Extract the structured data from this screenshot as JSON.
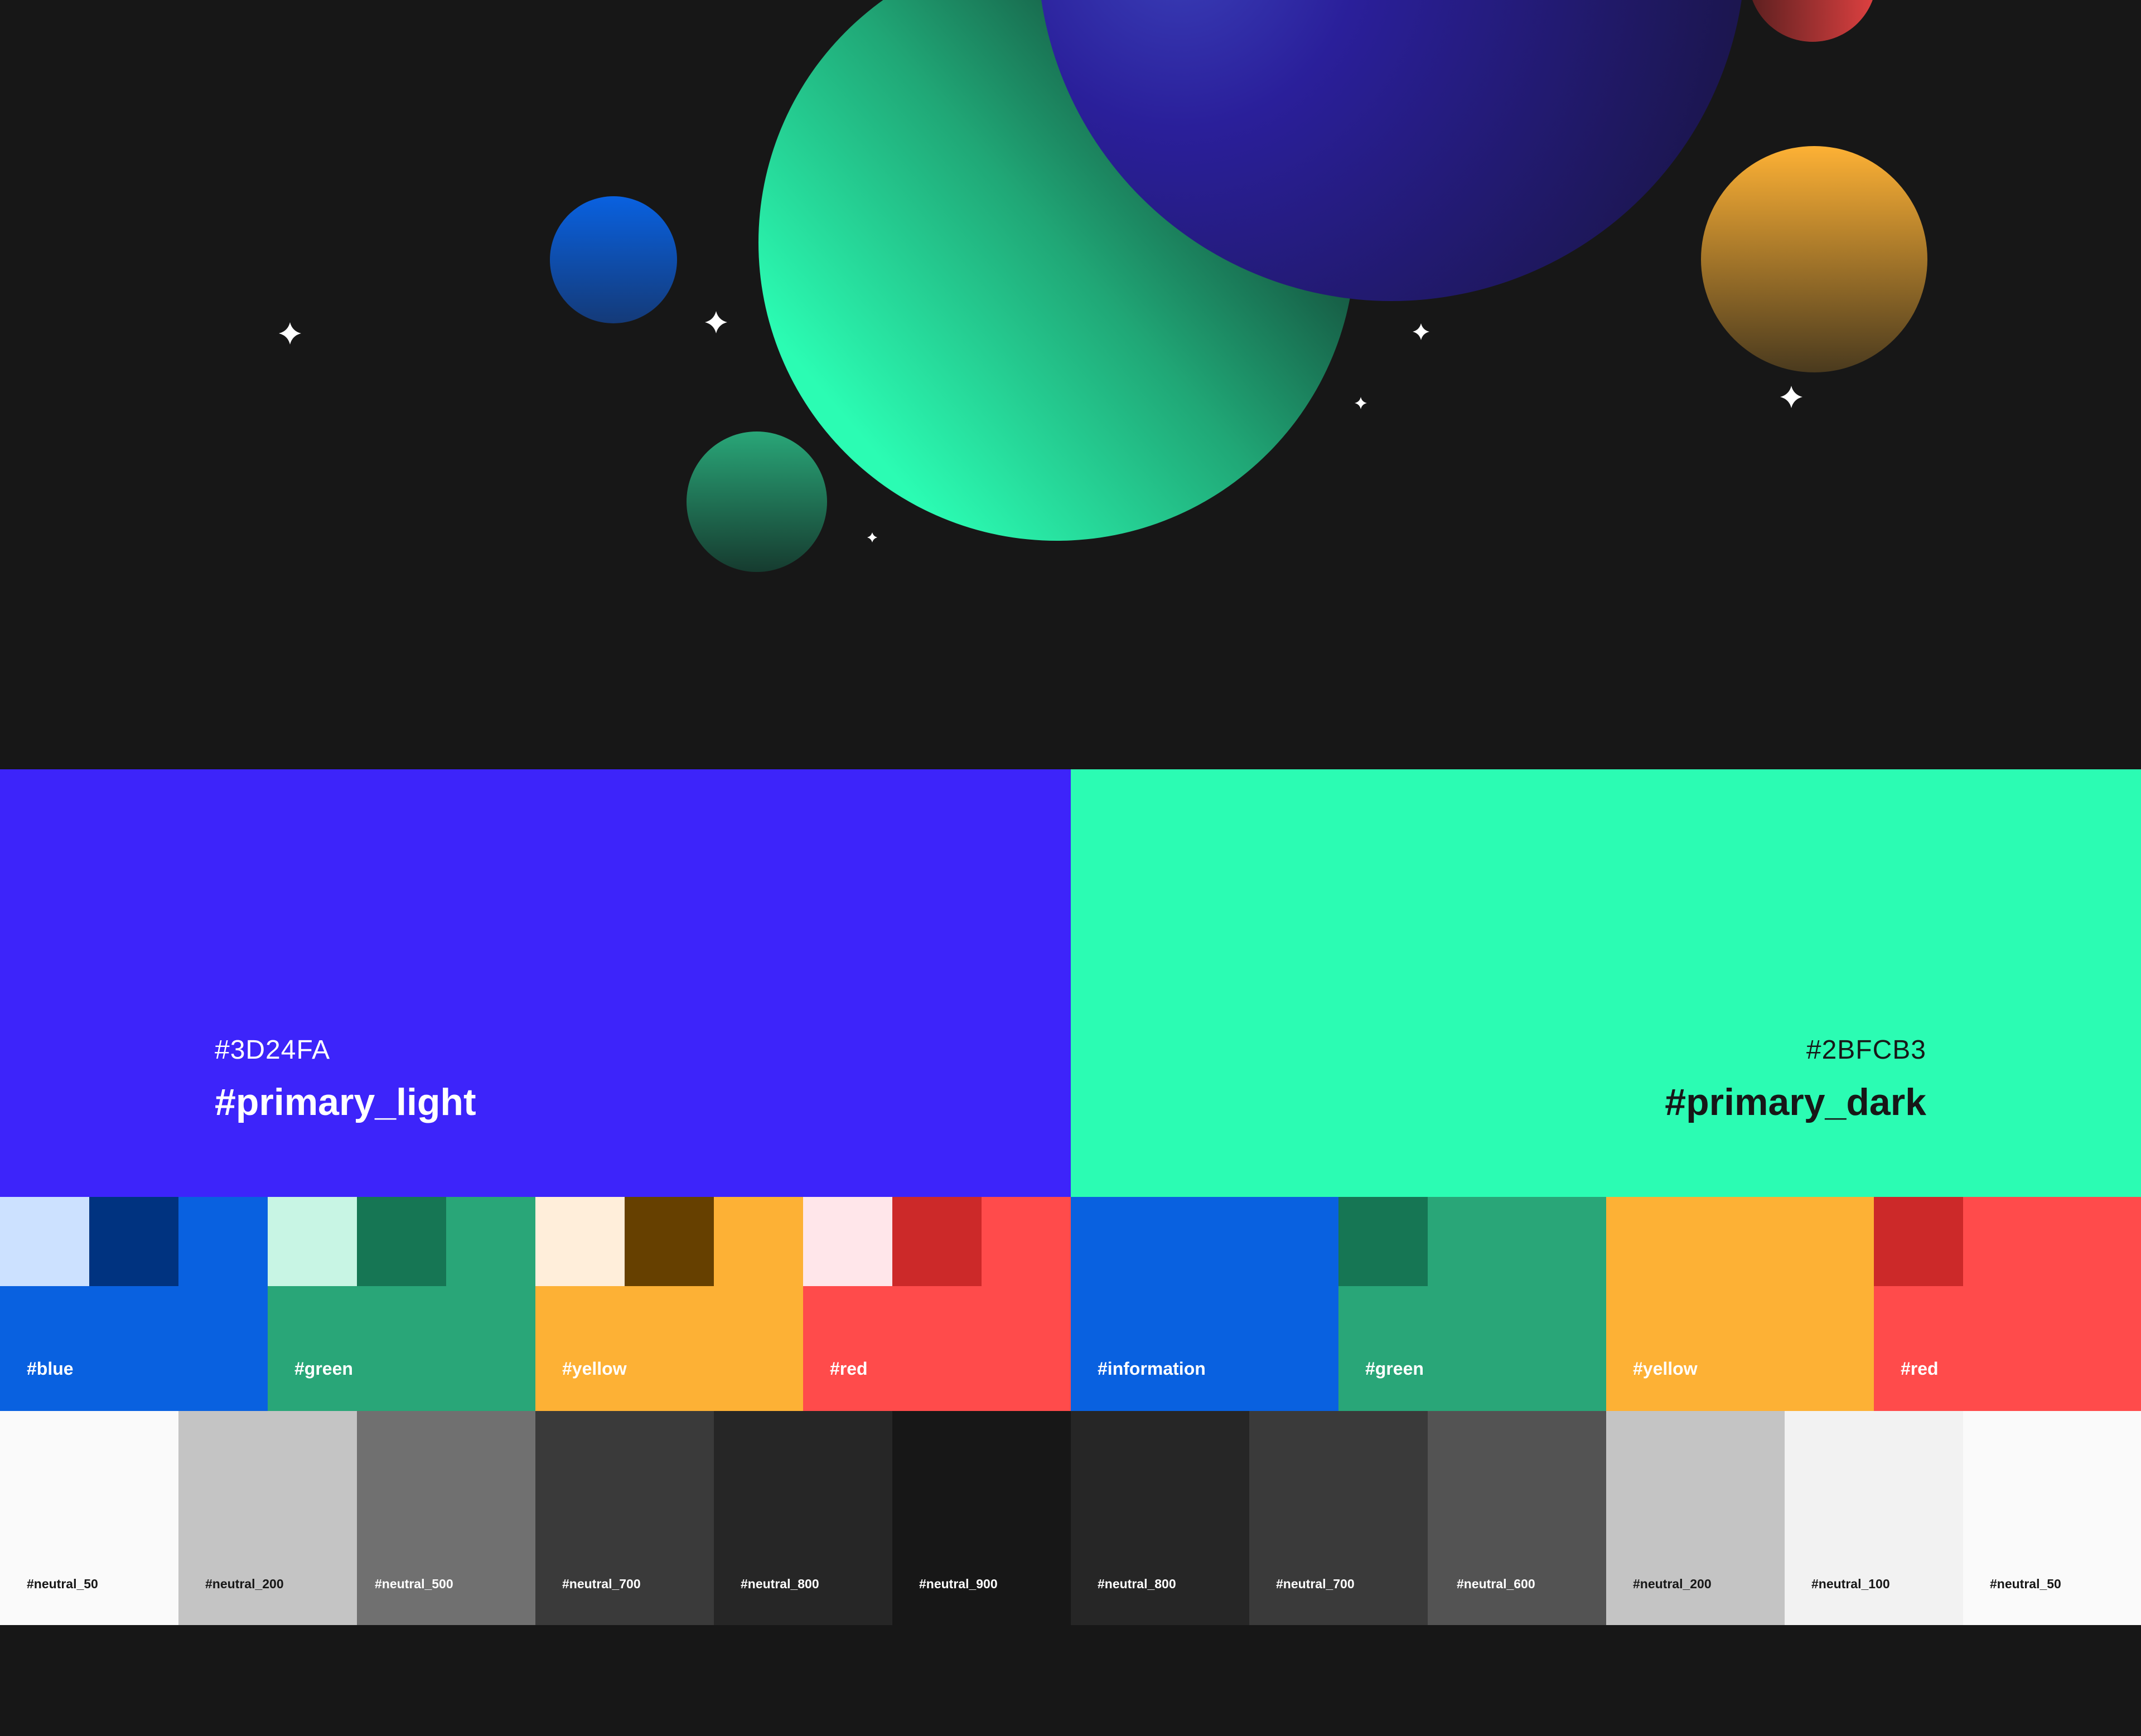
{
  "hero": {
    "colors": {
      "background": "#171717"
    }
  },
  "primary": {
    "light": {
      "hex": "#3D24FA",
      "name": "#primary_light",
      "color": "#3D24FA",
      "text_color": "#FFFFFF"
    },
    "dark": {
      "hex": "#2BFCB3",
      "name": "#primary_dark",
      "color": "#2BFCB3",
      "text_color": "#171717"
    }
  },
  "light_groups": [
    {
      "label": "#blue",
      "base": "#0961E0",
      "chips": [
        "#CCE1FF",
        "#003380"
      ]
    },
    {
      "label": "#green",
      "base": "#29A678",
      "chips": [
        "#C8F5E4",
        "#167654"
      ]
    },
    {
      "label": "#yellow",
      "base": "#FDB135",
      "chips": [
        "#FFEEDA",
        "#664000"
      ]
    },
    {
      "label": "#red",
      "base": "#FF4B4B",
      "chips": [
        "#FFE6EA",
        "#CC2929"
      ]
    }
  ],
  "dark_groups": [
    {
      "label": "#information",
      "base": "#0961E0",
      "chips": []
    },
    {
      "label": "#green",
      "base": "#29A678",
      "chips": [
        "#167654"
      ]
    },
    {
      "label": "#yellow",
      "base": "#FDB135",
      "chips": []
    },
    {
      "label": "#red",
      "base": "#FF4B4B",
      "chips": [
        "#CC2929"
      ]
    }
  ],
  "neutrals_light": [
    {
      "label": "#neutral_50",
      "color": "#FAFAFA",
      "text": "#171717"
    },
    {
      "label": "#neutral_200",
      "color": "#C4C4C4",
      "text": "#171717"
    },
    {
      "label": "#neutral_500",
      "color": "#707070",
      "text": "#FFFFFF"
    },
    {
      "label": "#neutral_700",
      "color": "#3A3A3A",
      "text": "#FFFFFF"
    },
    {
      "label": "#neutral_800",
      "color": "#262626",
      "text": "#FFFFFF"
    },
    {
      "label": "#neutral_900",
      "color": "#171717",
      "text": "#FFFFFF"
    }
  ],
  "neutrals_dark": [
    {
      "label": "#neutral_800",
      "color": "#262626",
      "text": "#FFFFFF"
    },
    {
      "label": "#neutral_700",
      "color": "#3A3A3A",
      "text": "#FFFFFF"
    },
    {
      "label": "#neutral_600",
      "color": "#535353",
      "text": "#FFFFFF"
    },
    {
      "label": "#neutral_200",
      "color": "#C4C4C4",
      "text": "#171717"
    },
    {
      "label": "#neutral_100",
      "color": "#F2F2F2",
      "text": "#171717"
    },
    {
      "label": "#neutral_50",
      "color": "#FAFAFA",
      "text": "#171717"
    }
  ]
}
